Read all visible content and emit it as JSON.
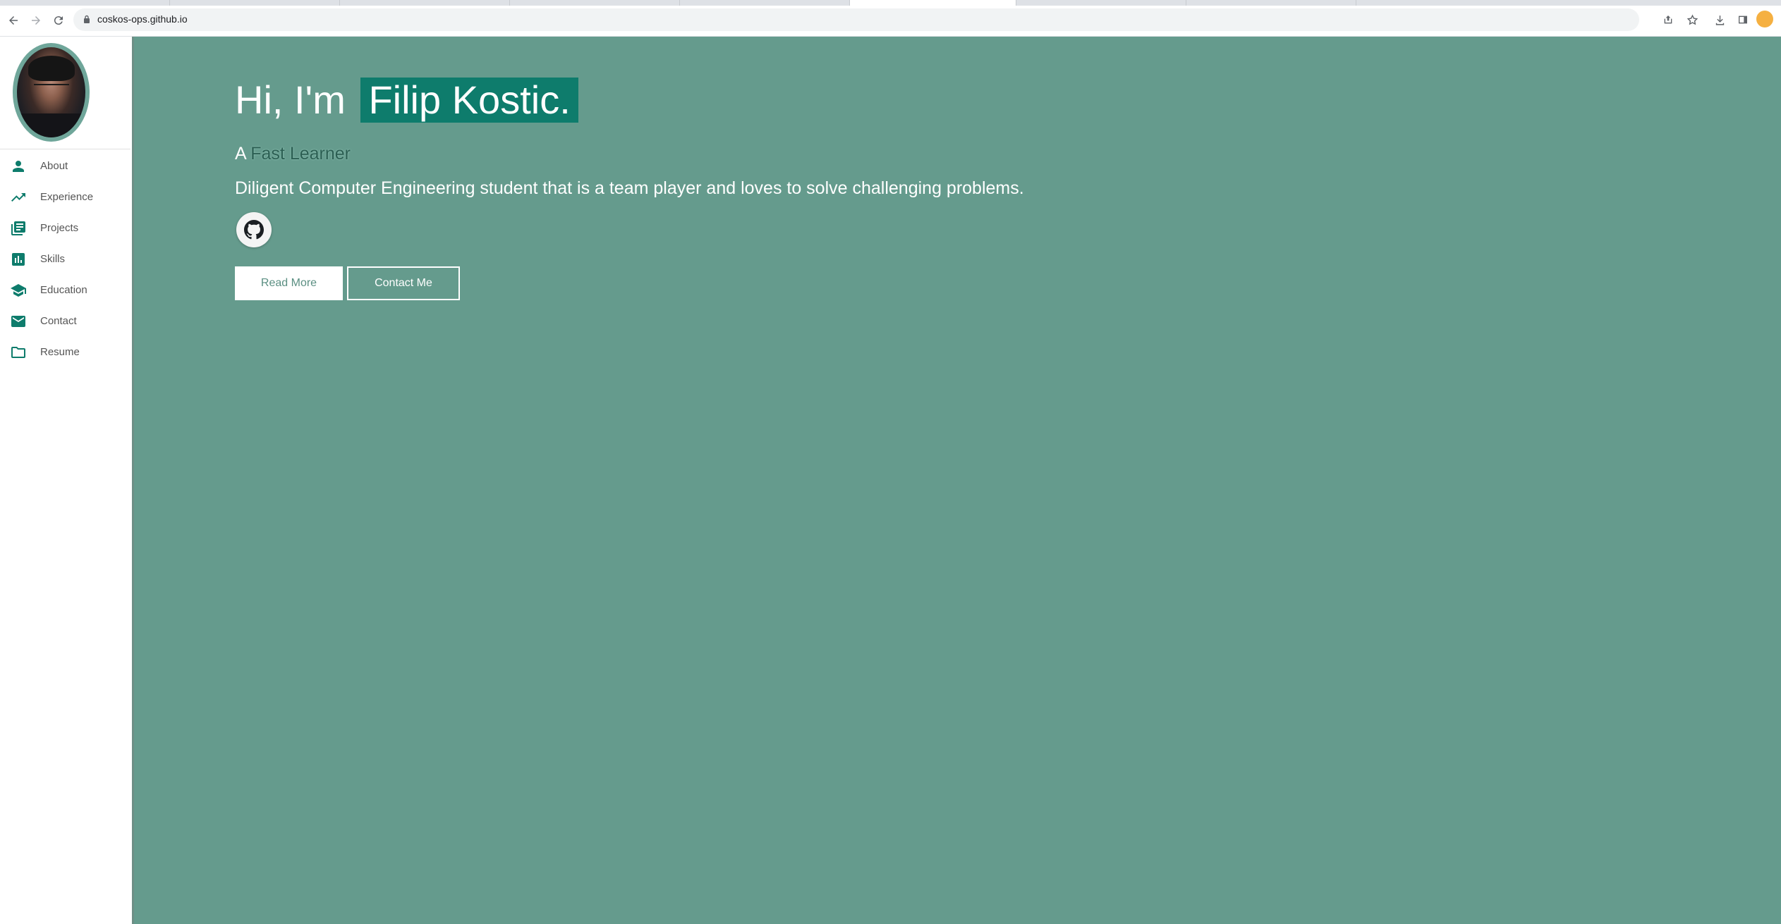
{
  "browser": {
    "url": "coskos-ops.github.io",
    "icons": [
      "back-icon",
      "forward-icon",
      "reload-icon",
      "lock-icon",
      "share-icon",
      "star-icon",
      "download-icon",
      "side-panel-icon",
      "profile-icon"
    ]
  },
  "sidebar": {
    "items": [
      {
        "label": "About",
        "icon": "person-icon"
      },
      {
        "label": "Experience",
        "icon": "trending-up-icon"
      },
      {
        "label": "Projects",
        "icon": "library-books-icon"
      },
      {
        "label": "Skills",
        "icon": "bar-chart-icon"
      },
      {
        "label": "Education",
        "icon": "school-icon"
      },
      {
        "label": "Contact",
        "icon": "mail-icon"
      },
      {
        "label": "Resume",
        "icon": "folder-icon"
      }
    ]
  },
  "hero": {
    "greeting": "Hi, I'm",
    "name": "Filip Kostic.",
    "article": "A",
    "role": "Fast Learner",
    "description": "Diligent Computer Engineering student that is a team player and loves to solve challenging problems.",
    "social_icon": "github-icon",
    "read_more": "Read More",
    "contact_me": "Contact Me"
  },
  "colors": {
    "hero_bg": "#659b8d",
    "name_highlight": "#0e7c6c",
    "icon_teal": "#0e7c6c"
  }
}
